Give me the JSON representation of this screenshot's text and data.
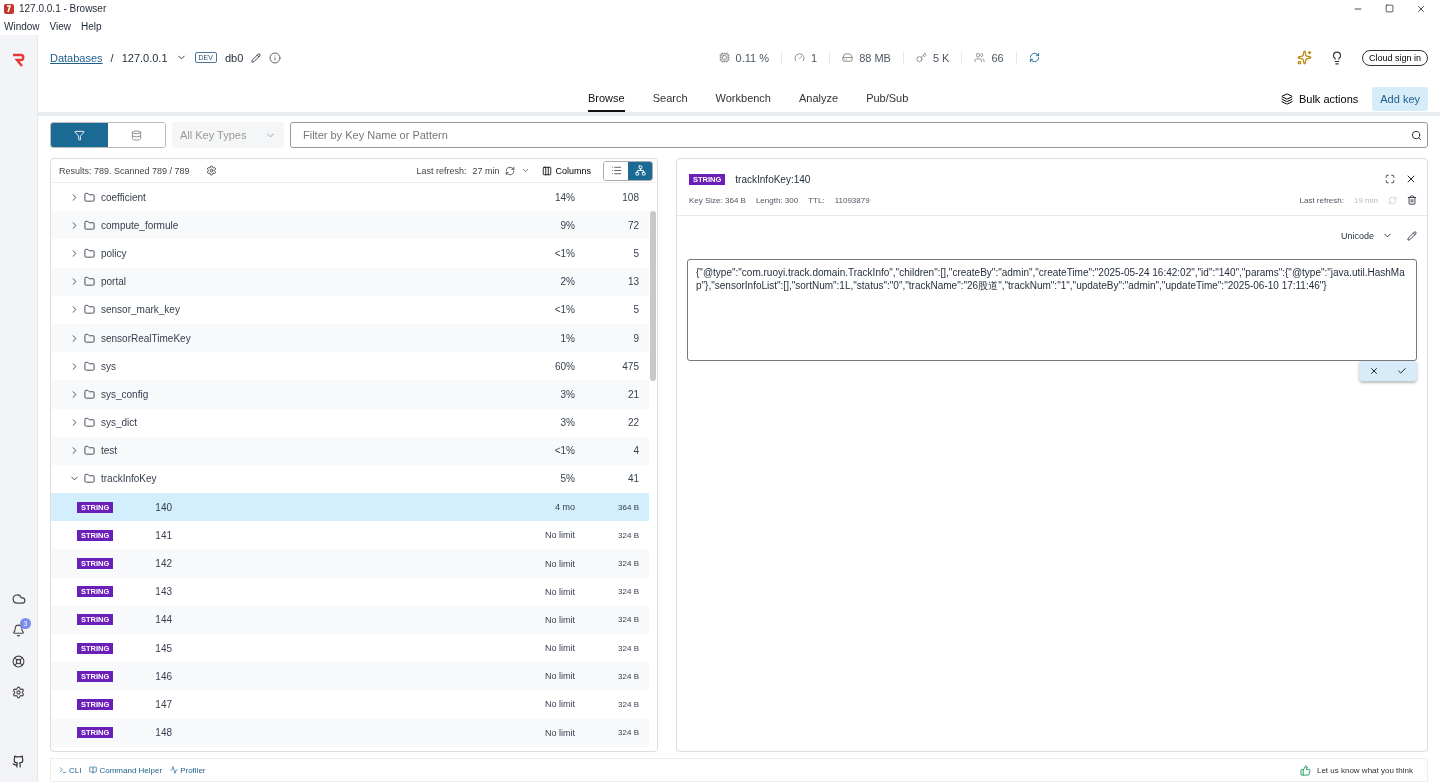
{
  "window": {
    "title": "127.0.0.1 - Browser"
  },
  "menu": [
    "Window",
    "View",
    "Help"
  ],
  "sidebar": {
    "notification_count": "3"
  },
  "header": {
    "breadcrumb_root": "Databases",
    "separator": "/",
    "host": "127.0.0.1",
    "env_badge": "DEV",
    "database": "db0",
    "stats": [
      {
        "kind": "cpu",
        "value": "0.11 %"
      },
      {
        "kind": "commands",
        "value": "1"
      },
      {
        "kind": "memory",
        "value": "88 MB"
      },
      {
        "kind": "keys",
        "value": "5 K"
      },
      {
        "kind": "clients",
        "value": "66"
      }
    ],
    "cloud_button": "Cloud sign in"
  },
  "tabs": [
    {
      "label": "Browse",
      "selected": true
    },
    {
      "label": "Search",
      "selected": false
    },
    {
      "label": "Workbench",
      "selected": false
    },
    {
      "label": "Analyze",
      "selected": false
    },
    {
      "label": "Pub/Sub",
      "selected": false
    }
  ],
  "actions": {
    "bulk": "Bulk actions",
    "add": "Add key"
  },
  "filter": {
    "modes": [
      {
        "kind": "filter",
        "selected": true
      },
      {
        "kind": "database",
        "selected": false
      }
    ],
    "key_type_placeholder": "All Key Types",
    "search_placeholder": "Filter by Key Name or Pattern"
  },
  "list": {
    "results": "Results: 789. Scanned 789 / 789",
    "refresh_label": "Last refresh:",
    "refresh_value": "27 min",
    "columns": "Columns",
    "tree_view": true,
    "rows": [
      {
        "kind": "folder",
        "name": "coefficient",
        "percent": "14%",
        "count": "108",
        "expanded": false
      },
      {
        "kind": "folder",
        "name": "compute_formule",
        "percent": "9%",
        "count": "72",
        "expanded": false
      },
      {
        "kind": "folder",
        "name": "policy",
        "percent": "<1%",
        "count": "5",
        "expanded": false
      },
      {
        "kind": "folder",
        "name": "portal",
        "percent": "2%",
        "count": "13",
        "expanded": false
      },
      {
        "kind": "folder",
        "name": "sensor_mark_key",
        "percent": "<1%",
        "count": "5",
        "expanded": false
      },
      {
        "kind": "folder",
        "name": "sensorRealTimeKey",
        "percent": "1%",
        "count": "9",
        "expanded": false
      },
      {
        "kind": "folder",
        "name": "sys",
        "percent": "60%",
        "count": "475",
        "expanded": false
      },
      {
        "kind": "folder",
        "name": "sys_config",
        "percent": "3%",
        "count": "21",
        "expanded": false
      },
      {
        "kind": "folder",
        "name": "sys_dict",
        "percent": "3%",
        "count": "22",
        "expanded": false
      },
      {
        "kind": "folder",
        "name": "test",
        "percent": "<1%",
        "count": "4",
        "expanded": false
      },
      {
        "kind": "folder",
        "name": "trackInfoKey",
        "percent": "5%",
        "count": "41",
        "expanded": true
      },
      {
        "kind": "key",
        "type": "STRING",
        "name": "140",
        "ttl": "4 mo",
        "size": "364 B",
        "selected": true
      },
      {
        "kind": "key",
        "type": "STRING",
        "name": "141",
        "ttl": "No limit",
        "size": "324 B",
        "selected": false
      },
      {
        "kind": "key",
        "type": "STRING",
        "name": "142",
        "ttl": "No limit",
        "size": "324 B",
        "selected": false
      },
      {
        "kind": "key",
        "type": "STRING",
        "name": "143",
        "ttl": "No limit",
        "size": "324 B",
        "selected": false
      },
      {
        "kind": "key",
        "type": "STRING",
        "name": "144",
        "ttl": "No limit",
        "size": "324 B",
        "selected": false
      },
      {
        "kind": "key",
        "type": "STRING",
        "name": "145",
        "ttl": "No limit",
        "size": "324 B",
        "selected": false
      },
      {
        "kind": "key",
        "type": "STRING",
        "name": "146",
        "ttl": "No limit",
        "size": "324 B",
        "selected": false
      },
      {
        "kind": "key",
        "type": "STRING",
        "name": "147",
        "ttl": "No limit",
        "size": "324 B",
        "selected": false
      },
      {
        "kind": "key",
        "type": "STRING",
        "name": "148",
        "ttl": "No limit",
        "size": "324 B",
        "selected": false
      }
    ]
  },
  "details": {
    "type": "STRING",
    "key": "trackInfoKey:140",
    "key_size": "Key Size: 364 B",
    "length": "Length: 300",
    "ttl_label": "TTL:",
    "ttl_value": "11093879",
    "refresh_label": "Last refresh:",
    "refresh_value": "19 min",
    "format": "Unicode",
    "value": "{\"@type\":\"com.ruoyi.track.domain.TrackInfo\",\"children\":[],\"createBy\":\"admin\",\"createTime\":\"2025-05-24 16:42:02\",\"id\":\"140\",\"params\":{\"@type\":\"java.util.HashMap\"},\"sensorInfoList\":[],\"sortNum\":1L,\"status\":\"0\",\"trackName\":\"26股道\",\"trackNum\":\"1\",\"updateBy\":\"admin\",\"updateTime\":\"2025-06-10 17:11:46\"}"
  },
  "bottom": {
    "tools": [
      "CLI",
      "Command Helper",
      "Profiler"
    ],
    "feedback": "Let us know what you think"
  }
}
